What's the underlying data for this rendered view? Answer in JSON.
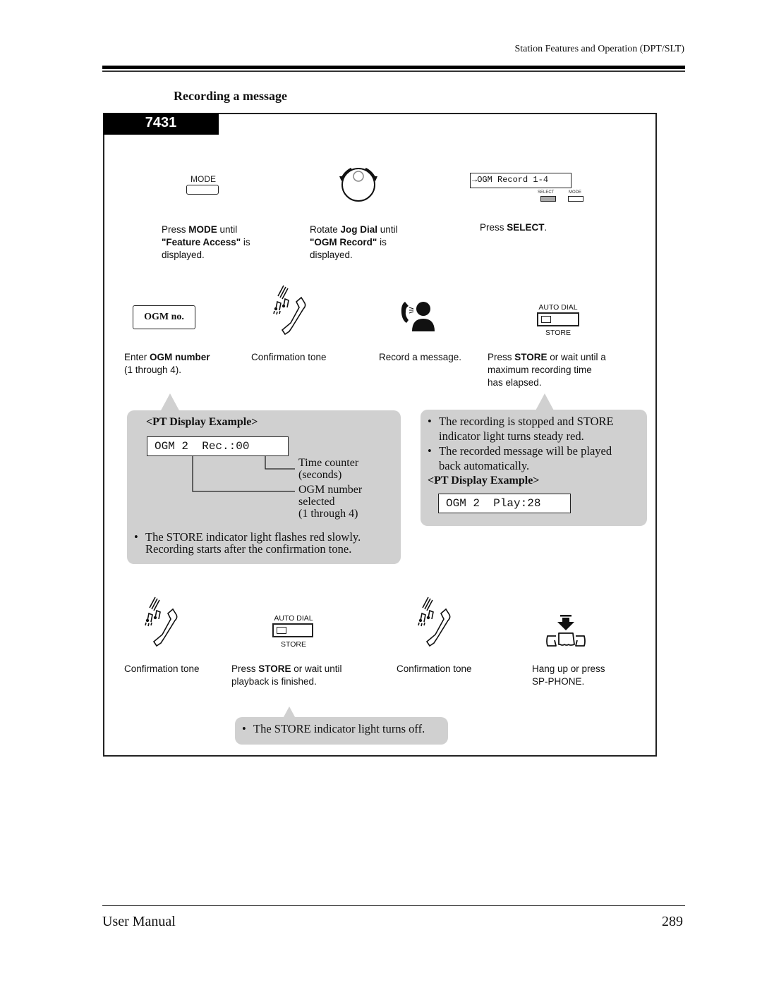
{
  "header": {
    "running_head": "Station Features and Operation (DPT/SLT)",
    "section_title": "Recording a message"
  },
  "procedure": {
    "code": "7431",
    "row1": {
      "mode_key_label": "MODE",
      "step1": {
        "pre": "Press ",
        "bold1": "MODE",
        "mid": " until",
        "bold2": "\"Feature Access\"",
        "post": " is",
        "end": "displayed."
      },
      "jog_icon": "jog-dial-icon",
      "step2": {
        "pre": "Rotate ",
        "bold1": "Jog Dial",
        "mid": " until",
        "bold2": "\"OGM Record\"",
        "post": " is",
        "end": "displayed."
      },
      "display_text": "→OGM Record 1-4",
      "select_label": "SELECT",
      "mode_small_label": "MODE",
      "step3": {
        "pre": "Press ",
        "bold1": "SELECT",
        "post": "."
      }
    },
    "row2": {
      "ogm_key_label": "OGM no.",
      "step4": {
        "pre": "Enter ",
        "bold1": "OGM",
        "bold2": " number",
        "end": "(1 through 4)."
      },
      "tone_icon": "confirmation-tone-icon",
      "step5": "Confirmation tone",
      "record_icon": "talking-person-icon",
      "step6": "Record a message.",
      "store_top_label": "AUTO DIAL",
      "store_bottom_label": "STORE",
      "step7": {
        "pre": "Press ",
        "bold1": "STORE",
        "post": " or wait until a",
        "line2": "maximum recording time",
        "line3": "has elapsed."
      }
    },
    "bubble_left": {
      "heading": "<PT Display Example>",
      "display_text": "OGM 2  Rec.:00",
      "callout_time": [
        "Time counter",
        "(seconds)"
      ],
      "callout_ogm": [
        "OGM number",
        "selected",
        "(1 through 4)"
      ],
      "bullet": [
        "The STORE indicator light flashes red slowly.",
        "Recording starts after the confirmation tone."
      ]
    },
    "bubble_right": {
      "bullets": [
        [
          "The recording is stopped and STORE",
          "indicator light turns steady red."
        ],
        [
          "The recorded message will be played",
          "back automatically."
        ]
      ],
      "heading": "<PT Display Example>",
      "display_text": "OGM 2  Play:28"
    },
    "row3": {
      "step8": "Confirmation tone",
      "store_top_label": "AUTO DIAL",
      "store_bottom_label": "STORE",
      "step9": {
        "pre": "Press ",
        "bold1": "STORE",
        "post": " or wait until",
        "line2": "playback is finished."
      },
      "step10": "Confirmation tone",
      "hangup_icon": "hang-up-icon",
      "step11": {
        "line1": "Hang up or press",
        "line2": "SP-PHONE."
      }
    },
    "bubble_bottom": {
      "bullet": "The STORE indicator light turns off."
    }
  },
  "footer": {
    "left": "User Manual",
    "page_number": "289"
  }
}
